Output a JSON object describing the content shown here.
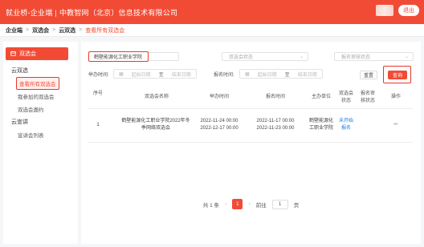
{
  "header": {
    "brand_left": "就业桥-企业端",
    "brand_sep": "|",
    "brand_right": "中教智网（北京）信息技术有限公司",
    "user_label": "退出"
  },
  "breadcrumb": {
    "items": [
      "企业端",
      "双选会",
      "云双选",
      "查看所有双选会"
    ],
    "separator": ">"
  },
  "sidebar": {
    "header_label": "双选会",
    "groups": [
      {
        "label": "云双选",
        "items": [
          "查看所有双选会",
          "我参加的双选会",
          "双选会邀约"
        ]
      },
      {
        "label": "云宣讲",
        "items": [
          "宣讲会列表"
        ]
      }
    ]
  },
  "filters": {
    "name_value": "鹤壁能源化工职业学院",
    "status_placeholder": "双选会状态",
    "review_placeholder": "报名审核状态",
    "hold_time_label": "举办时间:",
    "signup_time_label": "报名时间:",
    "range_start": "起始日期",
    "range_to": "至",
    "range_end": "结束日期",
    "reset_label": "重置",
    "query_label": "查询"
  },
  "table": {
    "headers": [
      "序号",
      "双选会名称",
      "举办时间",
      "报名时间",
      "主办单位",
      "双选会状态",
      "报名审核状态",
      "操作"
    ],
    "rows": [
      {
        "index": "1",
        "name_line1": "鹤壁能源化工职业学院2022年冬",
        "name_line2": "季网络双选会",
        "hold_start": "2022-11-24 00:00",
        "hold_end": "2022-12-17 00:00",
        "signup_start": "2022-11-17 00:00",
        "signup_end": "2022-11-23 00:00",
        "host_line1": "鹤壁能源化",
        "host_line2": "工职业学院",
        "status_line1": "未开始",
        "status_line2": "报名",
        "review": "",
        "op": "✏"
      }
    ]
  },
  "pager": {
    "total_text": "共 1 条",
    "prev": "‹",
    "current_page": "1",
    "next": "›",
    "goto_label": "前往",
    "goto_value": "1",
    "page_suffix": "页"
  }
}
